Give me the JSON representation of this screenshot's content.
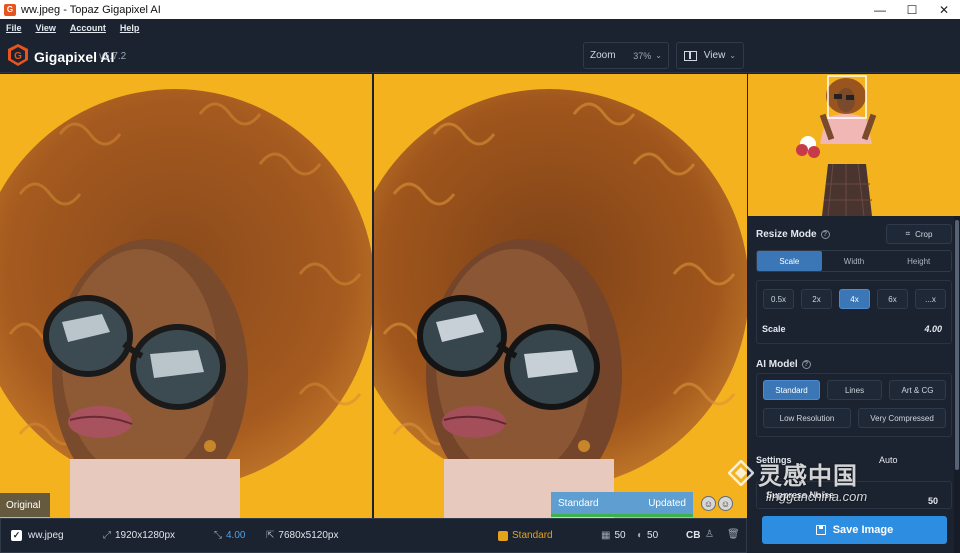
{
  "window": {
    "title": "ww.jpeg - Topaz Gigapixel AI",
    "minimize": "—",
    "maximize": "☐",
    "close": "✕"
  },
  "menu": {
    "items": [
      "File",
      "View",
      "Account",
      "Help"
    ]
  },
  "header": {
    "app_name": "Gigapixel AI",
    "version": "v5.7.2",
    "zoom_label": "Zoom",
    "zoom_value": "37%",
    "view_label": "View"
  },
  "preview": {
    "left_tag": "Original",
    "right_model": "Standard",
    "right_status": "Updated"
  },
  "bottom": {
    "filename": "ww.jpeg",
    "source_size": "1920x1280px",
    "scale": "4.00",
    "output_size": "7680x5120px",
    "model": "Standard",
    "noise_value": "50",
    "blur_value": "50",
    "color_mode": "CB"
  },
  "sidebar": {
    "resize_mode_title": "Resize Mode",
    "crop_label": "Crop",
    "resize_tabs": [
      "Scale",
      "Width",
      "Height"
    ],
    "active_resize_tab": 0,
    "scale_buttons": [
      "0.5x",
      "2x",
      "4x",
      "6x",
      "...x"
    ],
    "active_scale_button": 2,
    "scale_label": "Scale",
    "scale_value": "4.00",
    "ai_model_title": "AI Model",
    "ai_models_row1": [
      "Standard",
      "Lines",
      "Art & CG"
    ],
    "ai_models_row2": [
      "Low Resolution",
      "Very Compressed"
    ],
    "active_ai_model": "Standard",
    "settings_label": "Settings",
    "settings_mode": "Auto",
    "suppress_noise_label": "Suppress Noise",
    "suppress_noise_value": "50",
    "save_label": "Save Image"
  },
  "watermark": {
    "cn_text": "灵感中国",
    "en_text": "lingganchina.com"
  },
  "colors": {
    "background": "#1b2330",
    "accent_blue": "#2d8de0",
    "active_blue": "#3b76b6",
    "standard_orange": "#e3a31a",
    "photo_yellow": "#f4b21f"
  }
}
